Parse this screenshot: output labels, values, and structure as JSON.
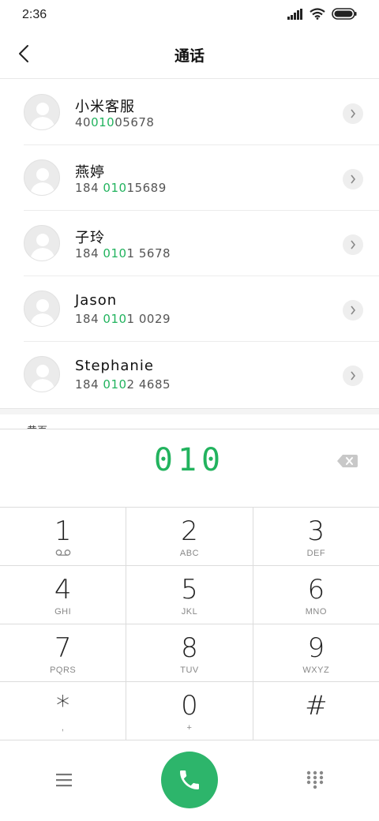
{
  "status": {
    "time": "2:36",
    "icons": [
      "signal-icon",
      "wifi-icon",
      "battery-icon"
    ]
  },
  "header": {
    "title": "通话",
    "back_icon": "chevron-left-icon"
  },
  "contacts": [
    {
      "name": "小米客服",
      "number_pre": "40",
      "number_match": "010",
      "number_post": "05678"
    },
    {
      "name": "燕婷",
      "number_pre": "184 ",
      "number_match": "010",
      "number_post": "15689"
    },
    {
      "name": "子玲",
      "number_pre": "184 ",
      "number_match": "010",
      "number_post": "1 5678"
    },
    {
      "name": "Jason",
      "number_pre": "184 ",
      "number_match": "010",
      "number_post": "1 0029"
    },
    {
      "name": "Stephanie",
      "number_pre": "184 ",
      "number_match": "010",
      "number_post": "2 4685"
    }
  ],
  "section_peek": "黄页",
  "dialer": {
    "number": "010",
    "backspace_icon": "backspace-icon"
  },
  "keypad": {
    "keys": [
      {
        "digit": "1",
        "letters": "",
        "sub_icon": "voicemail-icon"
      },
      {
        "digit": "2",
        "letters": "ABC"
      },
      {
        "digit": "3",
        "letters": "DEF"
      },
      {
        "digit": "4",
        "letters": "GHI"
      },
      {
        "digit": "5",
        "letters": "JKL"
      },
      {
        "digit": "6",
        "letters": "MNO"
      },
      {
        "digit": "7",
        "letters": "PQRS"
      },
      {
        "digit": "8",
        "letters": "TUV"
      },
      {
        "digit": "9",
        "letters": "WXYZ"
      },
      {
        "digit": "*",
        "letters": ","
      },
      {
        "digit": "0",
        "letters": "+"
      },
      {
        "digit": "#",
        "letters": ""
      }
    ]
  },
  "bottom_bar": {
    "menu_icon": "menu-icon",
    "call_icon": "phone-icon",
    "dialpad_icon": "dialpad-icon"
  },
  "colors": {
    "accent_green": "#22b35e",
    "call_button": "#2db56b"
  }
}
